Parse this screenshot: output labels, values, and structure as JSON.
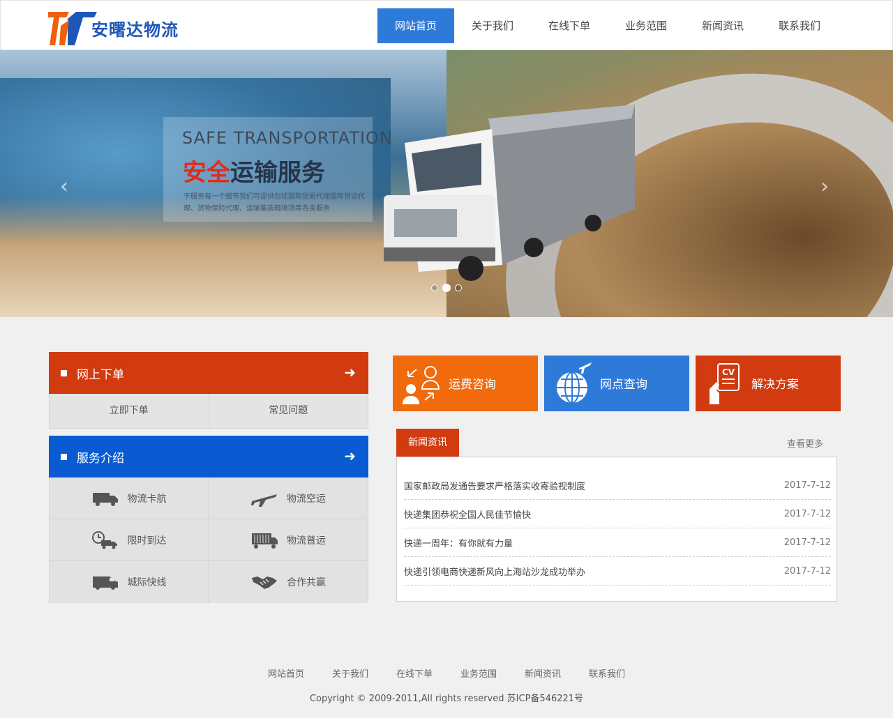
{
  "brand": {
    "name": "安曙达物流",
    "logo_colors": [
      "#f0600a",
      "#1e57b8"
    ]
  },
  "nav": {
    "items": [
      "网站首页",
      "关于我们",
      "在线下单",
      "业务范围",
      "新闻资讯",
      "联系我们"
    ],
    "active_index": 0
  },
  "banner": {
    "title_en": "SAFE TRANSPORTATION",
    "title_cn_red": "安全",
    "title_cn_dark": "运输服务",
    "desc": "于服务每一个细节我们可提供包括国际货易代理国际货运代理、货物保险代理、运输集装箱堆场等各类服务",
    "prev_icon": "‹",
    "next_icon": "›",
    "slides_total": 3,
    "slide_active": 2
  },
  "order_panel": {
    "title": "网上下单",
    "arrow": "➜",
    "buttons": [
      "立即下单",
      "常见问题"
    ]
  },
  "service_panel": {
    "title": "服务介绍",
    "arrow": "➜",
    "items": [
      {
        "label": "物流卡航",
        "icon": "truck-icon"
      },
      {
        "label": "物流空运",
        "icon": "airplane-icon"
      },
      {
        "label": "限时到达",
        "icon": "clock-truck-icon"
      },
      {
        "label": "物流普运",
        "icon": "container-icon"
      },
      {
        "label": "城际快线",
        "icon": "van-icon"
      },
      {
        "label": "合作共赢",
        "icon": "handshake-icon"
      }
    ]
  },
  "tiles": [
    {
      "label": "运费咨询",
      "color": "#f16a0c",
      "icon": "consult-icon"
    },
    {
      "label": "网点查询",
      "color": "#2e7ad9",
      "icon": "globe-plane-icon"
    },
    {
      "label": "解决方案",
      "color": "#d23a10",
      "icon": "cv-icon"
    }
  ],
  "news": {
    "tab": "新闻资讯",
    "more": "查看更多",
    "items": [
      {
        "title": "国家邮政局发通告要求严格落实收寄验视制度",
        "date": "2017-7-12"
      },
      {
        "title": "快递集团恭祝全国人民佳节愉快",
        "date": "2017-7-12"
      },
      {
        "title": "快递一周年：有你就有力量",
        "date": "2017-7-12"
      },
      {
        "title": "快递引领电商快递新风向上海站沙龙成功举办",
        "date": "2017-7-12"
      }
    ]
  },
  "footer": {
    "nav": [
      "网站首页",
      "关于我们",
      "在线下单",
      "业务范围",
      "新闻资讯",
      "联系我们"
    ],
    "copyright": "Copyright © 2009-2011,All rights reserved 苏ICP备546221号"
  }
}
